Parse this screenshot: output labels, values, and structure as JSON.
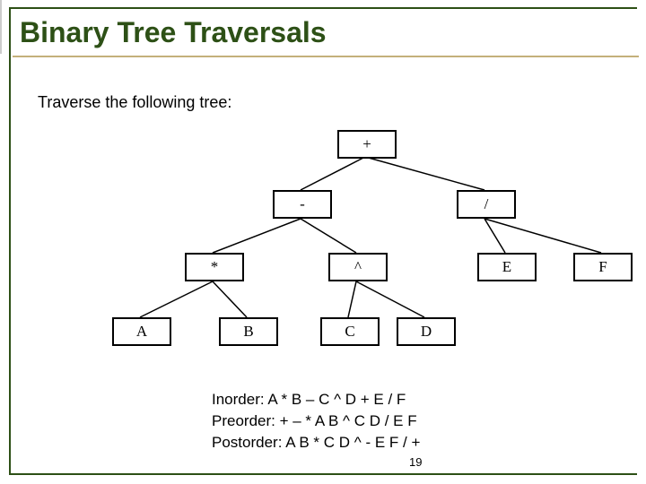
{
  "title": "Binary Tree Traversals",
  "subtitle": "Traverse the following tree:",
  "nodes": {
    "root": "+",
    "l": "-",
    "r": "/",
    "ll": "*",
    "lr": "^",
    "rl": "E",
    "rr": "F",
    "lll": "A",
    "llr": "B",
    "lrl": "C",
    "lrr": "D"
  },
  "results": {
    "inorder_label": "Inorder: ",
    "inorder_value": "A * B – C ^ D + E / F",
    "preorder_label": "Preorder:  ",
    "preorder_value": "+ – * A B ^  C D / E F",
    "postorder_label": "Postorder: ",
    "postorder_value": "A B * C D ^  - E F / +"
  },
  "page_number": "19"
}
